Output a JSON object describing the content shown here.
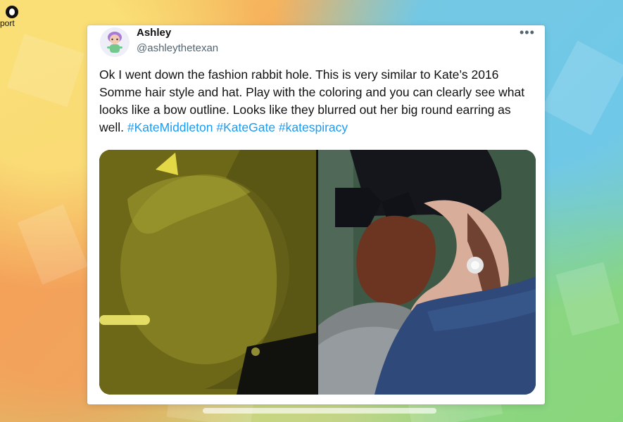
{
  "corner": {
    "label": "port"
  },
  "tweet": {
    "display_name": "Ashley",
    "handle": "@ashleythetexan",
    "more_label": "•••",
    "text_parts": [
      "Ok I went down the fashion rabbit hole. This is very similar to Kate’s 2016 Somme hair style and hat. Play with the coloring and you can clearly see what looks like a bow outline. Looks like they blurred out her big round earring as well. ",
      "#KateMiddleton",
      " ",
      "#KateGate",
      " ",
      "#katespiracy"
    ],
    "hashtag_color": "#1d9bf0"
  },
  "colors": {
    "card_bg": "#ffffff",
    "text": "#111111",
    "secondary_text": "#536471"
  },
  "icons": {
    "avatar": "avatar",
    "more": "more-icon",
    "corner": "app-icon"
  }
}
